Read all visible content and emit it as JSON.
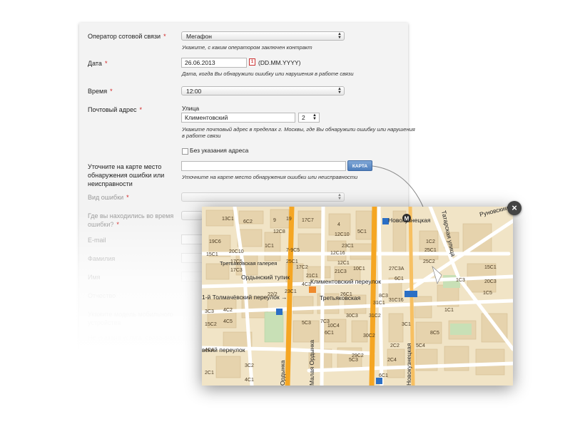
{
  "form": {
    "operator": {
      "label": "Оператор сотовой связи",
      "star": "*",
      "value": "Мегафон",
      "hint": "Укажите, с каким оператором заключен контракт"
    },
    "date": {
      "label": "Дата",
      "star": "*",
      "value": "26.06.2013",
      "format": "(DD.MM.YYYY)",
      "hint": "Дата, когда Вы обнаружили ошибку или нарушения в работе связи"
    },
    "time": {
      "label": "Время",
      "star": "*",
      "value": "12:00"
    },
    "address": {
      "label": "Почтовый адрес",
      "star": "*",
      "street_label": "Улица",
      "street_value": "Климентовский",
      "house_value": "2",
      "hint1": "Укажите почтовый адрес в пределах г. Москвы, где Вы обнаружили ошибку или нарушения",
      "hint2": "в работе связи",
      "no_address_label": "Без указания адреса"
    },
    "map_place": {
      "label1": "Уточните на карте место",
      "label2": "обнаружения ошибки или",
      "label3": "неисправности",
      "button": "КАРТА",
      "hint": "Уточните на карте место обнаружения ошибки или неисправности"
    },
    "error_type": {
      "label": "Вид ошибки",
      "star": "*"
    },
    "location": {
      "label1": "Где вы находились во время",
      "label2": "ошибки?",
      "star": "*"
    },
    "email": {
      "label": "E-mail"
    },
    "lastname": {
      "label": "Фамилия"
    },
    "firstname": {
      "label": "Имя"
    },
    "middlename": {
      "label": "Отчество"
    },
    "device_model": {
      "label1": "Укажите модель мобильного",
      "label2": "устройства"
    },
    "service": {
      "label": "Не указана услуга, связанная с"
    }
  },
  "map": {
    "close": "×",
    "streets": {
      "ordynsky": "Ордынский тупик",
      "klimentovsky": "Климентовский переулок",
      "tolmachevsky": "1-й Толмачёвский переулок →",
      "gallery": "Третьяковская галерея",
      "tretyakovskaya": "Третьяковская",
      "novokuz": "Новокузнецкая",
      "tatarskaya": "Татарская улица",
      "runovsky": "Руновский",
      "lavrushinsky": "вский переулок",
      "ordynka": "Ордынка",
      "malaya_ordynka": "Малая Ордынка",
      "novokuz_street": "Новокузнецкая"
    },
    "houses": [
      "13С1",
      "6С2",
      "9",
      "17С7",
      "4",
      "5С1",
      "12С8",
      "12С10",
      "12С16",
      "12С1",
      "10С1",
      "1С1",
      "7-9С5",
      "19С6",
      "20С10",
      "25С1",
      "17С5",
      "17С3",
      "4С3",
      "15С1",
      "21С1",
      "21С3",
      "22/2",
      "23С1",
      "26С1",
      "8С3",
      "3С3",
      "15С2",
      "4С4",
      "4С2",
      "4С5",
      "6С1",
      "5С3",
      "7С3",
      "30С3",
      "10С4",
      "30С2",
      "31С2",
      "31С16",
      "3С1",
      "1С3",
      "1С1",
      "8С5",
      "6С1",
      "1С5",
      "25С2",
      "25С1",
      "1С2",
      "5С3",
      "6С1",
      "2С2",
      "2С4",
      "3С2",
      "2С1",
      "4С1",
      "5С4",
      "19",
      "23С1",
      "31С1",
      "15С1",
      "20С3",
      "29С2",
      "27С3А",
      "17С2"
    ],
    "metro": "М"
  },
  "colors": {
    "accent": "#4f7fbd",
    "road_major": "#f5a623",
    "star": "#d01e1e",
    "close": "#444444"
  }
}
